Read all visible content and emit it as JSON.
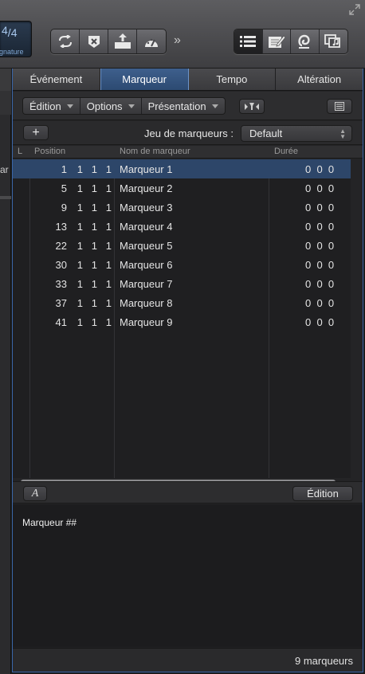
{
  "signature": {
    "value": "4/4",
    "numerator": "4",
    "denominator": "4",
    "label": "ignature"
  },
  "toolbar": {
    "group1": [
      "cycle-icon",
      "replace-icon",
      "bounce-icon",
      "metronome-icon"
    ],
    "more": "»",
    "group2": [
      "list-editors-icon",
      "notepad-icon",
      "loop-browser-icon",
      "media-browser-icon"
    ]
  },
  "left_strip": {
    "partial_text": "ar"
  },
  "tabs": [
    {
      "label": "Événement",
      "active": false
    },
    {
      "label": "Marqueur",
      "active": true
    },
    {
      "label": "Tempo",
      "active": false
    },
    {
      "label": "Altération",
      "active": false
    }
  ],
  "menu": {
    "edition": "Édition",
    "options": "Options",
    "presentation": "Présentation"
  },
  "marker_set": {
    "add": "+",
    "label": "Jeu de marqueurs :",
    "value": "Default"
  },
  "columns": {
    "lock": "L",
    "position": "Position",
    "name": "Nom de marqueur",
    "duration": "Durée"
  },
  "markers": [
    {
      "bar": "1",
      "beat": "1",
      "div": "1",
      "tick": "1",
      "name": "Marqueur 1",
      "duration": "0  0  0",
      "selected": true
    },
    {
      "bar": "5",
      "beat": "1",
      "div": "1",
      "tick": "1",
      "name": "Marqueur 2",
      "duration": "0  0  0",
      "selected": false
    },
    {
      "bar": "9",
      "beat": "1",
      "div": "1",
      "tick": "1",
      "name": "Marqueur 3",
      "duration": "0  0  0",
      "selected": false
    },
    {
      "bar": "13",
      "beat": "1",
      "div": "1",
      "tick": "1",
      "name": "Marqueur 4",
      "duration": "0  0  0",
      "selected": false
    },
    {
      "bar": "22",
      "beat": "1",
      "div": "1",
      "tick": "1",
      "name": "Marqueur 5",
      "duration": "0  0  0",
      "selected": false
    },
    {
      "bar": "30",
      "beat": "1",
      "div": "1",
      "tick": "1",
      "name": "Marqueur 6",
      "duration": "0  0  0",
      "selected": false
    },
    {
      "bar": "33",
      "beat": "1",
      "div": "1",
      "tick": "1",
      "name": "Marqueur 7",
      "duration": "0  0  0",
      "selected": false
    },
    {
      "bar": "37",
      "beat": "1",
      "div": "1",
      "tick": "1",
      "name": "Marqueur 8",
      "duration": "0  0  0",
      "selected": false
    },
    {
      "bar": "41",
      "beat": "1",
      "div": "1",
      "tick": "1",
      "name": "Marqueur 9",
      "duration": "0  0  0",
      "selected": false
    }
  ],
  "notes": {
    "font_button": "A",
    "edit_button": "Édition",
    "text": "Marqueur ##"
  },
  "status": {
    "count": "9 marqueurs"
  },
  "colors": {
    "accent": "#3a66a8",
    "selected_row": "#2d4669",
    "active_tab": "#3e5f8d"
  }
}
